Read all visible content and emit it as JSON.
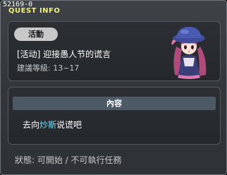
{
  "window": {
    "id_label": "52169-0",
    "title": "QUEST INFO"
  },
  "quest": {
    "category_badge": "活動",
    "name": "[活动] 迎接愚人节的谎言",
    "level_requirement": "建議等級: 13~17",
    "npc_portrait_icon": "npc-portrait-icon"
  },
  "content": {
    "header": "內容",
    "prefix": "去向",
    "npc_name": "炒斯",
    "suffix": "说谎吧",
    "npc_name_color": "#6fe0ff"
  },
  "status": {
    "text": "狀態: 可開始 / 不可執行任務"
  }
}
